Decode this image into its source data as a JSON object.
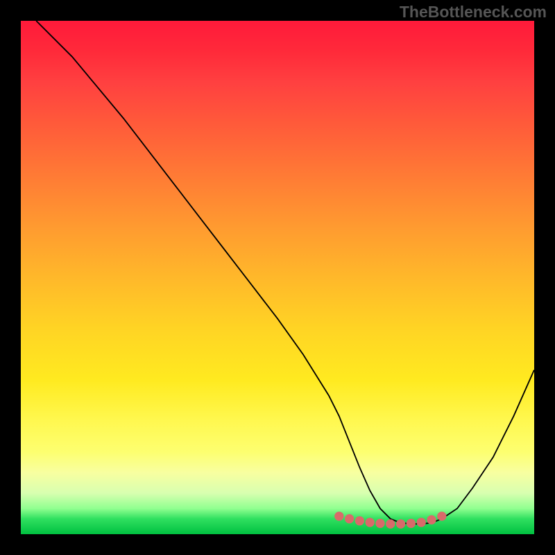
{
  "watermark": "TheBottleneck.com",
  "chart_data": {
    "type": "line",
    "title": "",
    "xlabel": "",
    "ylabel": "",
    "xlim": [
      0,
      100
    ],
    "ylim": [
      0,
      100
    ],
    "series": [
      {
        "name": "bottleneck-curve",
        "x": [
          3,
          6,
          10,
          15,
          20,
          25,
          30,
          35,
          40,
          45,
          50,
          55,
          60,
          62,
          64,
          66,
          68,
          70,
          72,
          74,
          76,
          78,
          80,
          82,
          85,
          88,
          92,
          96,
          100
        ],
        "y": [
          100,
          97,
          93,
          87,
          81,
          74.5,
          68,
          61.5,
          55,
          48.5,
          42,
          35,
          27,
          23,
          18,
          13,
          8.5,
          5,
          3,
          2.2,
          2,
          2,
          2.2,
          3,
          5,
          9,
          15,
          23,
          32
        ]
      }
    ],
    "markers": {
      "name": "highlight-points",
      "color": "#d86a6a",
      "x": [
        62,
        64,
        66,
        68,
        70,
        72,
        74,
        76,
        78,
        80,
        82
      ],
      "y": [
        3.5,
        3,
        2.6,
        2.3,
        2.1,
        2,
        2,
        2.1,
        2.3,
        2.8,
        3.5
      ]
    },
    "gradient_stops": [
      {
        "pos": 0,
        "color": "#ff1a3a"
      },
      {
        "pos": 50,
        "color": "#ffd424"
      },
      {
        "pos": 85,
        "color": "#fdff70"
      },
      {
        "pos": 100,
        "color": "#00c040"
      }
    ]
  }
}
